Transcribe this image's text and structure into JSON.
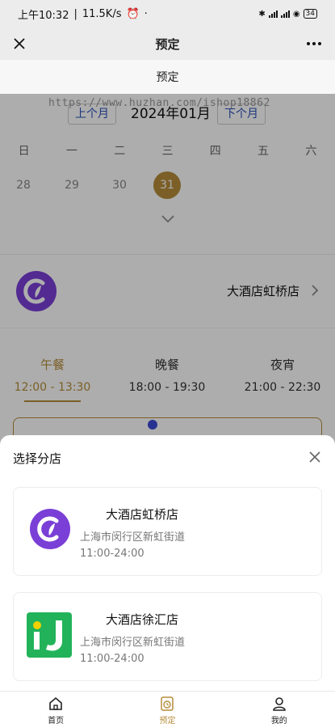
{
  "status_bar": {
    "time": "上午10:32",
    "speed": "11.5K/s",
    "battery": "34"
  },
  "nav": {
    "title": "预定"
  },
  "subheader": {
    "title": "预定"
  },
  "watermark": "https://www.huzhan.com/ishop18862",
  "calendar": {
    "prev_label": "上个月",
    "month": "2024年01月",
    "next_label": "下个月",
    "weekdays": [
      "日",
      "一",
      "二",
      "三",
      "四",
      "五",
      "六"
    ],
    "days": [
      "28",
      "29",
      "30",
      "31"
    ],
    "selected_day": "31"
  },
  "current_shop": {
    "name": "大酒店虹桥店"
  },
  "meals": [
    {
      "name": "午餐",
      "time": "12:00 - 13:30",
      "active": true
    },
    {
      "name": "晚餐",
      "time": "18:00 - 19:30",
      "active": false
    },
    {
      "name": "夜宵",
      "time": "21:00 - 22:30",
      "active": false
    }
  ],
  "sheet": {
    "title": "选择分店",
    "shops": [
      {
        "name": "大酒店虹桥店",
        "address": "上海市闵行区新虹街道",
        "hours": "11:00-24:00",
        "logo": "purple-c-logo"
      },
      {
        "name": "大酒店徐汇店",
        "address": "上海市闵行区新虹街道",
        "hours": "11:00-24:00",
        "logo": "green-j-logo"
      }
    ]
  },
  "tabbar": {
    "items": [
      {
        "label": "首页",
        "icon": "home-icon"
      },
      {
        "label": "预定",
        "icon": "reserve-icon",
        "active": true
      },
      {
        "label": "我的",
        "icon": "user-icon"
      }
    ]
  },
  "colors": {
    "accent": "#b58c3a",
    "brand_purple": "#7a3fd6",
    "brand_green": "#22b35a",
    "link_blue": "#2a4fb8"
  }
}
